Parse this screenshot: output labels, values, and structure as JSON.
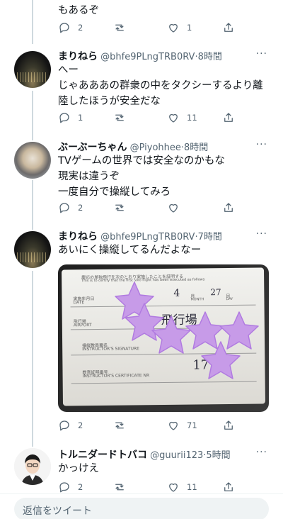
{
  "tweets": [
    {
      "id": "t0",
      "text_lines": [
        "もあるぞ"
      ],
      "reply_count": "2",
      "like_count": "1",
      "retweet_count": ""
    },
    {
      "id": "t1",
      "name": "まりねら",
      "handle": "@bhfe9PLngTRB0RV",
      "time": "·8時間",
      "text_lines": [
        "へー",
        "じゃあああの群衆の中をタクシーするより離",
        "陸したほうが安全だな"
      ],
      "reply_count": "1",
      "like_count": "11",
      "retweet_count": ""
    },
    {
      "id": "t2",
      "name": "ぶーぶーちゃん",
      "handle": "@Piyohhee",
      "time": "·8時間",
      "text_lines": [
        "TVゲームの世界では安全なのかもな",
        "現実は違うぞ",
        "一度自分で操縦してみろ"
      ],
      "reply_count": "2",
      "like_count": "",
      "retweet_count": ""
    },
    {
      "id": "t3",
      "name": "まりねら",
      "handle": "@bhfe9PLngTRB0RV",
      "time": "·7時間",
      "text_lines": [
        "あいにく操縦してるんだよなー"
      ],
      "reply_count": "2",
      "like_count": "71",
      "retweet_count": ""
    },
    {
      "id": "t4",
      "name": "トルニダードトバコ",
      "handle": "@guurii123",
      "time": "·5時間",
      "text_lines": [
        "かっけえ"
      ],
      "reply_count": "2",
      "like_count": "11",
      "retweet_count": ""
    }
  ],
  "media": {
    "line1": "慶応の単独飛行を次のとおり実施したことを証明する",
    "line2": "This is to certify that the first solo flight has been executed as follows",
    "date_label": "実施年月日",
    "date_label_en": "DATE",
    "airport_label": "飛行場",
    "airport_label_en": "AIRPORT",
    "instructor_label": "操縦教員署名",
    "instructor_label_en": "INSTRUCTOR'S SIGNATURE",
    "cert_label": "教育証明番号",
    "cert_label_en": "INSTRUCTOR'S CERTIFICATE NR",
    "handwritten_month": "4",
    "month_label": "月",
    "month_label_en": "MONTH",
    "handwritten_day": "27",
    "day_label": "日",
    "day_label_en": "DAY",
    "handwritten_airport": "飛行場",
    "handwritten_cert": "17"
  },
  "reply_box": {
    "placeholder": "返信をツイート"
  },
  "icons": {
    "reply": "reply-icon",
    "retweet": "retweet-icon",
    "like": "heart-icon",
    "share": "share-icon",
    "more": "more-icon"
  },
  "colors": {
    "secondary_text": "#536471",
    "primary_text": "#0f1419",
    "sticker": "#c79be8"
  }
}
